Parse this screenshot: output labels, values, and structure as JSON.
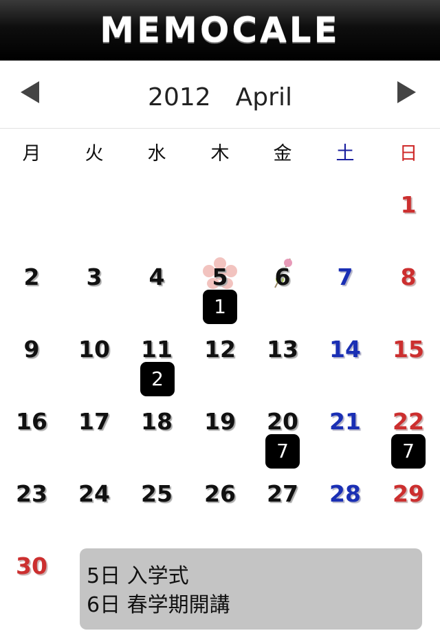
{
  "app": {
    "title": "MEMOCALE"
  },
  "nav": {
    "month_label": "2012　April",
    "prev_icon": "triangle-left-icon",
    "next_icon": "triangle-right-icon"
  },
  "weekdays": [
    "月",
    "火",
    "水",
    "木",
    "金",
    "土",
    "日"
  ],
  "colors": {
    "weekday_text": "#111111",
    "saturday": "#1a2fb4",
    "sunday": "#cc2f2f",
    "badge_bg": "#000000",
    "memo_bg": "#c4c4c4"
  },
  "days": [
    "1",
    "2",
    "3",
    "4",
    "5",
    "6",
    "7",
    "8",
    "9",
    "10",
    "11",
    "12",
    "13",
    "14",
    "15",
    "16",
    "17",
    "18",
    "19",
    "20",
    "21",
    "22",
    "23",
    "24",
    "25",
    "26",
    "27",
    "28",
    "29",
    "30"
  ],
  "badges": [
    {
      "day": "5",
      "count": "1"
    },
    {
      "day": "11",
      "count": "2"
    },
    {
      "day": "20",
      "count": "7"
    },
    {
      "day": "22",
      "count": "7"
    }
  ],
  "day_icons": [
    {
      "day": "5",
      "icon": "sakura-icon"
    },
    {
      "day": "6",
      "icon": "dango-icon"
    }
  ],
  "memo": {
    "lines": [
      "5日 入学式",
      "6日 春学期開講"
    ]
  }
}
